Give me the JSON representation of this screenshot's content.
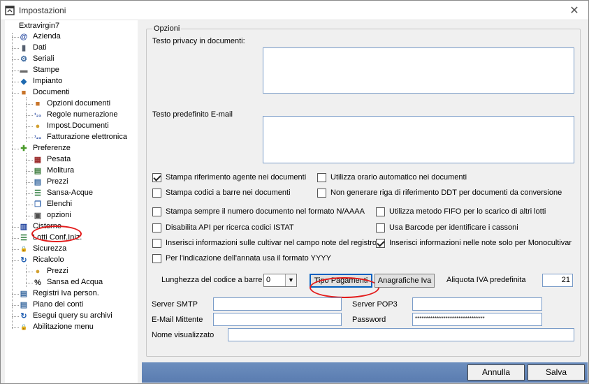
{
  "window": {
    "title": "Impostazioni"
  },
  "tree": {
    "root": "Extravirgin7",
    "items": [
      {
        "label": "Azienda",
        "icon": "at-icon",
        "glyph": "@",
        "color": "#1a3e9c",
        "level": 0
      },
      {
        "label": "Dati",
        "icon": "database-icon",
        "glyph": "▮",
        "color": "#556070",
        "level": 0
      },
      {
        "label": "Seriali",
        "icon": "network-icon",
        "glyph": "⚙",
        "color": "#3c6aa0",
        "level": 0
      },
      {
        "label": "Stampe",
        "icon": "printer-icon",
        "glyph": "▬",
        "color": "#6a6a6a",
        "level": 0
      },
      {
        "label": "Impianto",
        "icon": "diamond-icon",
        "glyph": "◆",
        "color": "#1f6ab0",
        "level": 0
      },
      {
        "label": "Documenti",
        "icon": "box-icon",
        "glyph": "■",
        "color": "#c8742a",
        "level": 0
      },
      {
        "label": "Opzioni documenti",
        "icon": "box-icon",
        "glyph": "■",
        "color": "#c8742a",
        "level": 1
      },
      {
        "label": "Regole numerazione",
        "icon": "numbers-icon",
        "glyph": "¹₂₃",
        "color": "#1a3e9c",
        "level": 1
      },
      {
        "label": "Impost.Documenti",
        "icon": "settings-icon",
        "glyph": "●",
        "color": "#d2a030",
        "level": 1
      },
      {
        "label": "Fatturazione elettronica",
        "icon": "numbers-icon",
        "glyph": "¹₂₃",
        "color": "#1a3e9c",
        "level": 1
      },
      {
        "label": "Preferenze",
        "icon": "puzzle-icon",
        "glyph": "✚",
        "color": "#4a9a2a",
        "level": 0
      },
      {
        "label": "Pesata",
        "icon": "grid-icon",
        "glyph": "▦",
        "color": "#9a2a2a",
        "level": 1
      },
      {
        "label": "Molitura",
        "icon": "document-icon",
        "glyph": "▤",
        "color": "#3a7a3a",
        "level": 1
      },
      {
        "label": "Prezzi",
        "icon": "document-icon",
        "glyph": "▤",
        "color": "#3a6aa0",
        "level": 1
      },
      {
        "label": "Sansa-Acque",
        "icon": "list-icon",
        "glyph": "☰",
        "color": "#2a7a3a",
        "level": 1
      },
      {
        "label": "Elenchi",
        "icon": "copy-icon",
        "glyph": "❐",
        "color": "#3a6ab0",
        "level": 1
      },
      {
        "label": "opzioni",
        "icon": "window-icon",
        "glyph": "▣",
        "color": "#505050",
        "level": 1
      },
      {
        "label": "Cisterne",
        "icon": "tank-icon",
        "glyph": "▥",
        "color": "#1a3e9c",
        "level": 0
      },
      {
        "label": "Lotti Conf.Iniz.",
        "icon": "list-icon",
        "glyph": "☰",
        "color": "#2a7a3a",
        "level": 0
      },
      {
        "label": "Sicurezza",
        "icon": "lock-icon",
        "glyph": "🔒",
        "color": "#c89020",
        "level": 0
      },
      {
        "label": "Ricalcolo",
        "icon": "refresh-icon",
        "glyph": "↻",
        "color": "#1a5ab0",
        "level": 0
      },
      {
        "label": "Prezzi",
        "icon": "settings-icon",
        "glyph": "●",
        "color": "#d2a030",
        "level": 1
      },
      {
        "label": "Sansa ed Acqua",
        "icon": "percent-icon",
        "glyph": "%",
        "color": "#222222",
        "level": 1
      },
      {
        "label": "Registri Iva person.",
        "icon": "document-icon",
        "glyph": "▤",
        "color": "#3a6aa0",
        "level": 0
      },
      {
        "label": "Piano dei conti",
        "icon": "document-icon",
        "glyph": "▤",
        "color": "#3a6aa0",
        "level": 0
      },
      {
        "label": "Esegui query su archivi",
        "icon": "refresh-icon",
        "glyph": "↻",
        "color": "#1a5ab0",
        "level": 0
      },
      {
        "label": "Abilitazione menu",
        "icon": "lock-icon",
        "glyph": "🔒",
        "color": "#c89020",
        "level": 0
      }
    ]
  },
  "options": {
    "legend": "Opzioni",
    "privacy_label": "Testo privacy in documenti:",
    "email_text_label": "Testo predefinito E-mail",
    "checkboxes": [
      {
        "label": "Stampa riferimento agente nei documenti",
        "checked": true
      },
      {
        "label": "Utilizza orario automatico nei documenti",
        "checked": false
      },
      {
        "label": "Stampa codici a barre nei documenti",
        "checked": false
      },
      {
        "label": "Non generare riga di riferimento DDT per documenti da conversione",
        "checked": false
      },
      {
        "label": "Stampa sempre il numero documento nel formato N/AAAA",
        "checked": false
      },
      {
        "label": "Utilizza metodo FIFO per lo scarico di altri lotti",
        "checked": false
      },
      {
        "label": "Disabilita API per ricerca codici ISTAT",
        "checked": false
      },
      {
        "label": "Usa Barcode per identificare i cassoni",
        "checked": false
      },
      {
        "label": "Inserisci informazioni sulle cultivar nel campo note del registro",
        "checked": false
      },
      {
        "label": "Inserisci informazioni nelle note solo per Monocultivar",
        "checked": true
      },
      {
        "label": "Per l'indicazione dell'annata usa il formato YYYY",
        "checked": false
      }
    ],
    "barcode_length_label": "Lunghezza del codice a barre",
    "barcode_length_value": "0",
    "tipo_pagamenti_label": "Tipo Pagamenti",
    "anagrafiche_iva_label": "Anagrafiche Iva",
    "aliquota_label": "Aliquota IVA predefinita",
    "aliquota_value": "21",
    "server_smtp_label": "Server SMTP",
    "server_smtp_value": "",
    "server_pop3_label": "Server POP3",
    "server_pop3_value": "",
    "email_mittente_label": "E-Mail Mittente",
    "email_mittente_value": "",
    "password_label": "Password",
    "password_value": "********************************",
    "nome_visualizzato_label": "Nome visualizzato",
    "nome_visualizzato_value": ""
  },
  "footer": {
    "cancel_label": "Annulla",
    "save_label": "Salva"
  },
  "colors": {
    "accent_bar": "#6c8ebe",
    "annotation": "#e31b1b",
    "field_border": "#7a9cc8"
  }
}
